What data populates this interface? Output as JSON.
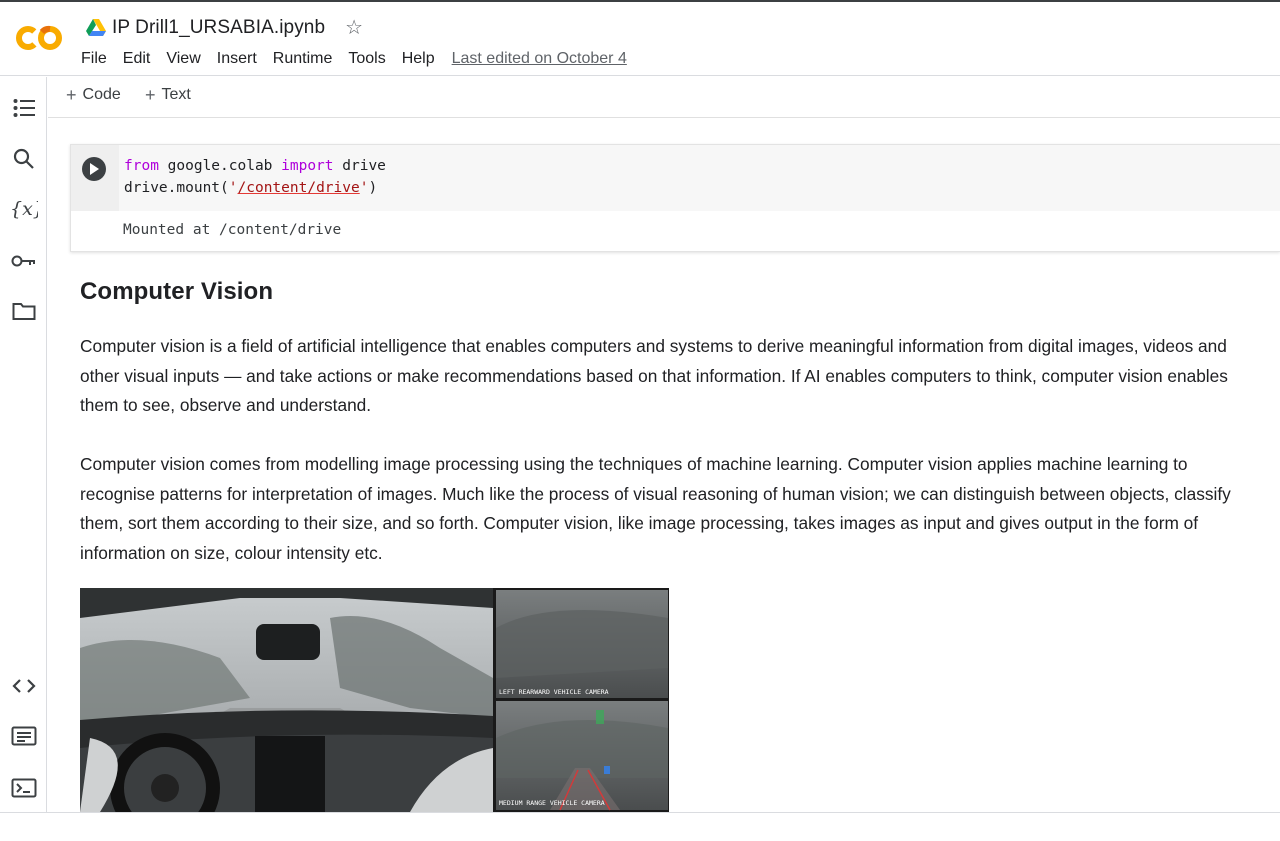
{
  "header": {
    "logo_text": "CO",
    "file_name": "IP Drill1_URSABIA.ipynb",
    "star_icon": "star-outline-icon",
    "menu": [
      "File",
      "Edit",
      "View",
      "Insert",
      "Runtime",
      "Tools",
      "Help"
    ],
    "last_edited": "Last edited on October 4"
  },
  "sidebar": {
    "items": [
      {
        "icon": "table-of-contents-icon"
      },
      {
        "icon": "search-icon"
      },
      {
        "icon": "variables-icon"
      },
      {
        "icon": "key-icon"
      },
      {
        "icon": "folder-icon"
      }
    ],
    "bottom_items": [
      {
        "icon": "code-snippets-icon"
      },
      {
        "icon": "command-palette-icon"
      },
      {
        "icon": "terminal-icon"
      }
    ]
  },
  "toolbar": {
    "add_code": "Code",
    "add_text": "Text"
  },
  "code_cell": {
    "line1_kw1": "from",
    "line1_mod": " google.colab ",
    "line1_kw2": "import",
    "line1_name": " drive",
    "line2_prefix": "drive.mount(",
    "line2_quote_open": "'",
    "line2_string": "/content/drive",
    "line2_quote_close": "'",
    "line2_suffix": ")",
    "output": "Mounted at /content/drive"
  },
  "text_cell": {
    "heading": "Computer Vision",
    "paragraphs": [
      "Computer vision is a field of artificial intelligence that enables computers and systems to derive meaningful information from digital images, videos and other visual inputs — and take actions or make recommendations based on that information. If AI enables computers to think, computer vision enables them to see, observe and understand.",
      "Computer vision comes from modelling image processing using the techniques of machine learning. Computer vision applies machine learning to recognise patterns for interpretation of images. Much like the process of visual reasoning of human vision; we can distinguish between objects, classify them, sort them according to their size, and so forth. Computer vision, like image processing, takes images as input and gives output in the form of information on size, colour intensity etc."
    ],
    "figure": {
      "label_top": "LEFT REARWARD VEHICLE CAMERA",
      "label_bottom": "MEDIUM RANGE VEHICLE CAMERA"
    }
  },
  "colors": {
    "logo_orange": "#F9AB00",
    "logo_dark_orange": "#E8710A",
    "keyword": "#af00db",
    "string": "#a31515"
  }
}
